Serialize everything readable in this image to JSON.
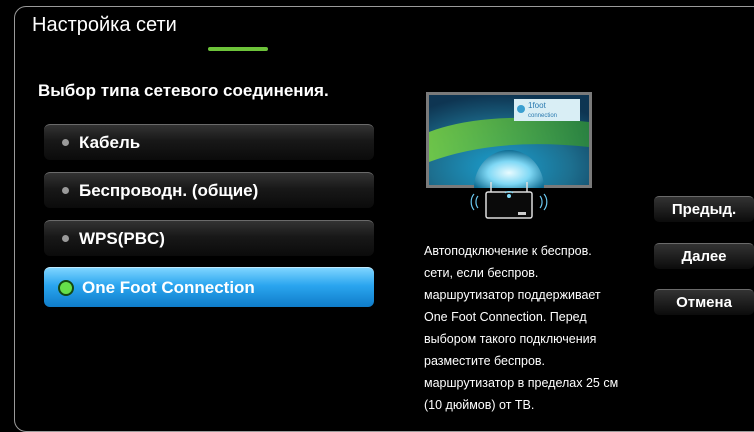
{
  "title": "Настройка сети",
  "subtitle": "Выбор типа сетевого соединения.",
  "options": [
    {
      "label": "Кабель",
      "selected": false
    },
    {
      "label": "Беспроводн. (общие)",
      "selected": false
    },
    {
      "label": "WPS(PBC)",
      "selected": false
    },
    {
      "label": "One Foot Connection",
      "selected": true
    }
  ],
  "illustration": {
    "logo_top": "1foot",
    "logo_bottom": "connection"
  },
  "description": "Автоподключение к беспров. сети, если беспров. маршрутизатор поддерживает One Foot Connection. Перед выбором такого подключения разместите беспров. маршрутизатор в пределах 25 см (10 дюймов) от ТВ.",
  "buttons": {
    "prev": "Предыд.",
    "next": "Далее",
    "cancel": "Отмена"
  },
  "colors": {
    "selected": "#2aa5ef",
    "accent_green": "#6dc33a"
  }
}
